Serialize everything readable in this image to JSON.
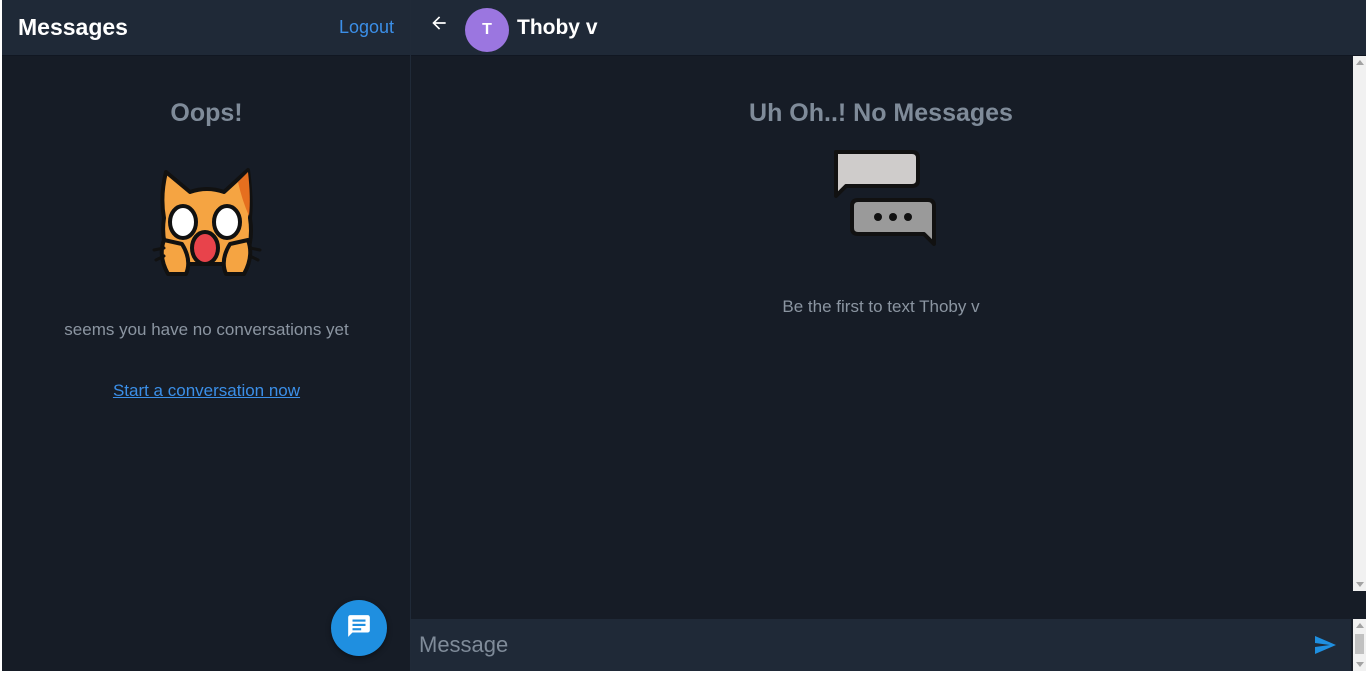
{
  "sidebar": {
    "title": "Messages",
    "logout_label": "Logout",
    "empty_state": {
      "title": "Oops!",
      "icon": "shocked-cat-icon",
      "message": "seems you have no conversations yet",
      "link_label": "Start a conversation now"
    },
    "fab_icon": "chat-message-icon"
  },
  "chat": {
    "back_icon": "arrow-left-icon",
    "contact": {
      "avatar_initial": "T",
      "name": "Thoby v",
      "avatar_color": "#9b76e0"
    },
    "empty_state": {
      "title": "Uh Oh..! No Messages",
      "icon": "speech-bubbles-icon",
      "message": "Be the first to text Thoby v"
    },
    "composer": {
      "placeholder": "Message",
      "value": "",
      "send_icon": "send-icon"
    }
  },
  "colors": {
    "background": "#161c26",
    "header": "#1f2937",
    "accent": "#3b8fe8",
    "fab": "#1f8fe0",
    "muted_text": "#7f8b99"
  }
}
